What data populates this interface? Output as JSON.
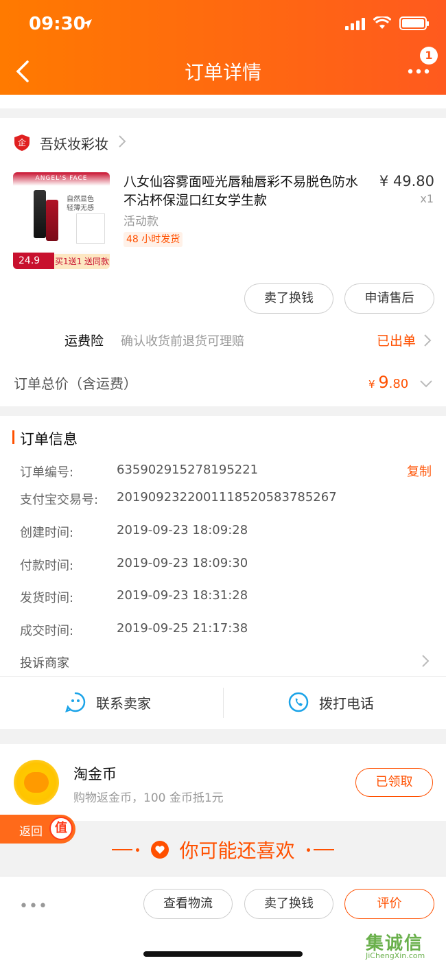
{
  "status_bar": {
    "time": "09:30"
  },
  "header": {
    "title": "订单详情",
    "badge_count": "1"
  },
  "shop": {
    "name": "吾妖妆彩妆"
  },
  "product": {
    "title": "八女仙容雾面哑光唇釉唇彩不易脱色防水不沾杯保湿口红女学生款",
    "price": "¥ 49.80",
    "quantity": "x1",
    "variant": "活动款",
    "shipping_tag": "48 小时发货",
    "image": {
      "brand": "ANGEL'S FACE",
      "line1": "自然显色",
      "line2": "轻薄无感",
      "price": "24.9",
      "promo": "买1送1 送同款"
    }
  },
  "item_actions": {
    "sell_label": "卖了换钱",
    "after_sale_label": "申请售后"
  },
  "insurance": {
    "label": "运费险",
    "desc": "确认收货前退货可理赔",
    "status": "已出单"
  },
  "total": {
    "label": "订单总价（含运费）",
    "currency": "¥ ",
    "integer": "9",
    "decimal": ".80"
  },
  "order_info": {
    "title": "订单信息",
    "copy_label": "复制",
    "rows": [
      {
        "label": "订单编号:",
        "value": "635902915278195221"
      },
      {
        "label": "支付宝交易号:",
        "value": "2019092322001118520583785267"
      },
      {
        "label": "创建时间:",
        "value": "2019-09-23 18:09:28"
      },
      {
        "label": "付款时间:",
        "value": "2019-09-23 18:09:30"
      },
      {
        "label": "发货时间:",
        "value": "2019-09-23 18:31:28"
      },
      {
        "label": "成交时间:",
        "value": "2019-09-25 21:17:38"
      }
    ],
    "complain_label": "投诉商家"
  },
  "contact": {
    "chat_label": "联系卖家",
    "call_label": "拨打电话"
  },
  "coins": {
    "title": "淘金币",
    "desc": "购物返金币，100 金币抵1元",
    "button_label": "已领取"
  },
  "back_tab": {
    "label": "返回",
    "icon_text": "值"
  },
  "recommend": {
    "title": "你可能还喜欢"
  },
  "bottom_bar": {
    "more": "•••",
    "logistics_label": "查看物流",
    "sell_label": "卖了换钱",
    "review_label": "评价"
  },
  "watermark": {
    "cn": "集诚信",
    "en": "JiChengXin.com"
  },
  "colors": {
    "accent": "#ff5000",
    "header_start": "#ff7a00",
    "header_end": "#ff5a1e"
  }
}
